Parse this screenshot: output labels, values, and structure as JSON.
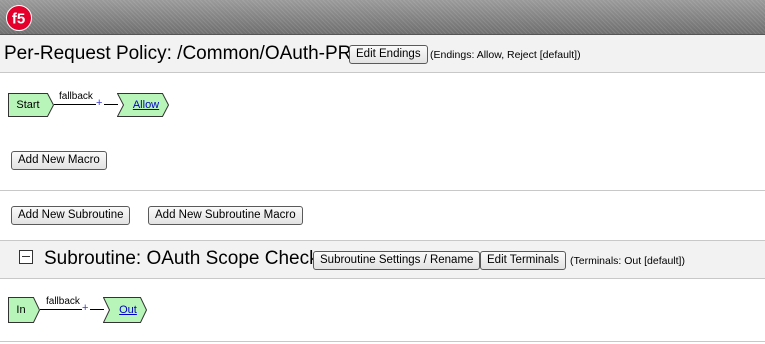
{
  "header": {
    "logo_text": "f5",
    "brand_color": "#e4002b"
  },
  "policy": {
    "title": "Per-Request Policy: /Common/OAuth-PRP",
    "edit_endings_label": "Edit Endings",
    "endings_note": "(Endings: Allow, Reject [default])"
  },
  "main_flow": {
    "start_label": "Start",
    "branch_label": "fallback",
    "plus_symbol": "+",
    "end_label": "Allow",
    "node_fill": "#b8f5b8"
  },
  "actions": {
    "add_macro_label": "Add New Macro",
    "add_subroutine_label": "Add New Subroutine",
    "add_subroutine_macro_label": "Add New Subroutine Macro"
  },
  "subroutine": {
    "title": "Subroutine: OAuth Scope Check",
    "settings_label": "Subroutine Settings / Rename",
    "edit_terminals_label": "Edit Terminals",
    "terminals_note": "(Terminals: Out [default])",
    "collapse_icon": "minus-box-icon"
  },
  "sub_flow": {
    "in_label": "In",
    "branch_label": "fallback",
    "plus_symbol": "+",
    "out_label": "Out"
  }
}
